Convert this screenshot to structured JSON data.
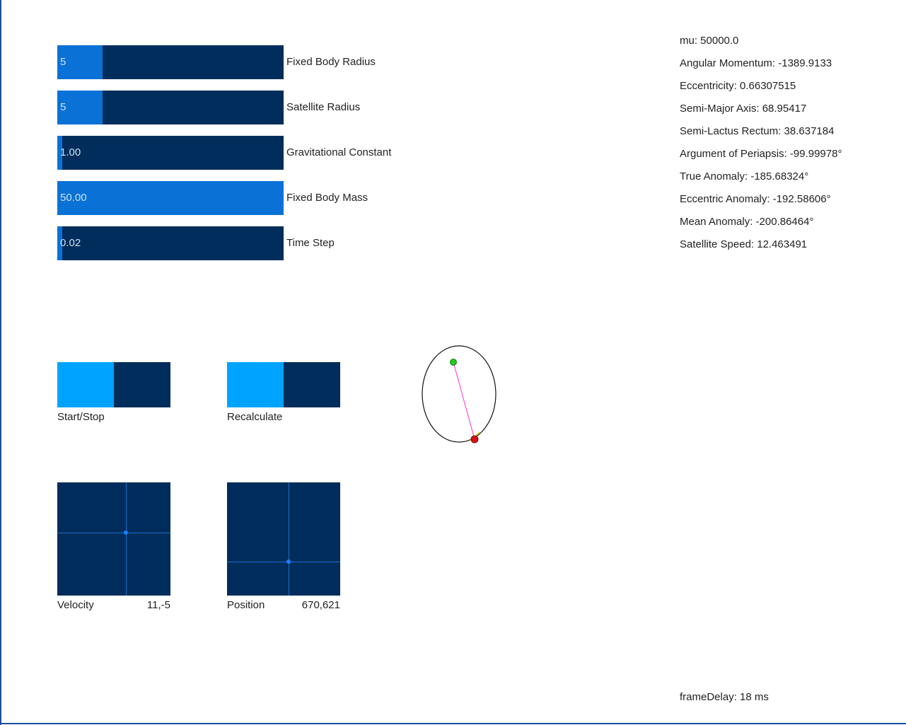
{
  "sliders": [
    {
      "value": "5",
      "label": "Fixed Body Radius",
      "fraction": 0.2
    },
    {
      "value": "5",
      "label": "Satellite Radius",
      "fraction": 0.2
    },
    {
      "value": "1.00",
      "label": "Gravitational Constant",
      "fraction": 0.02
    },
    {
      "value": "50.00",
      "label": "Fixed Body Mass",
      "fraction": 1.0
    },
    {
      "value": "0.02",
      "label": "Time Step",
      "fraction": 0.02
    }
  ],
  "toggles": {
    "start_stop": {
      "label": "Start/Stop"
    },
    "recalculate": {
      "label": "Recalculate"
    }
  },
  "pads": {
    "velocity": {
      "label": "Velocity",
      "value": "11,-5"
    },
    "position": {
      "label": "Position",
      "value": "670,621"
    }
  },
  "stats": [
    "mu: 50000.0",
    "Angular Momentum: -1389.9133",
    "Eccentricity: 0.66307515",
    "Semi-Major Axis: 68.95417",
    "Semi-Lactus Rectum: 38.637184",
    "Argument of Periapsis: -99.99978°",
    "True Anomaly: -185.68324°",
    "Eccentric Anomaly: -192.58606°",
    "Mean Anomaly: -200.86464°",
    "Satellite Speed: 12.463491"
  ],
  "frame_delay": "frameDelay: 18 ms",
  "colors": {
    "track": "#002d5b",
    "fill": "#0a72d6",
    "toggle_on": "#00a3ff",
    "fixed_body": "#22cc22",
    "satellite": "#dd1111",
    "radius_line": "#ff33cc",
    "frame": "#1d4f9c"
  }
}
